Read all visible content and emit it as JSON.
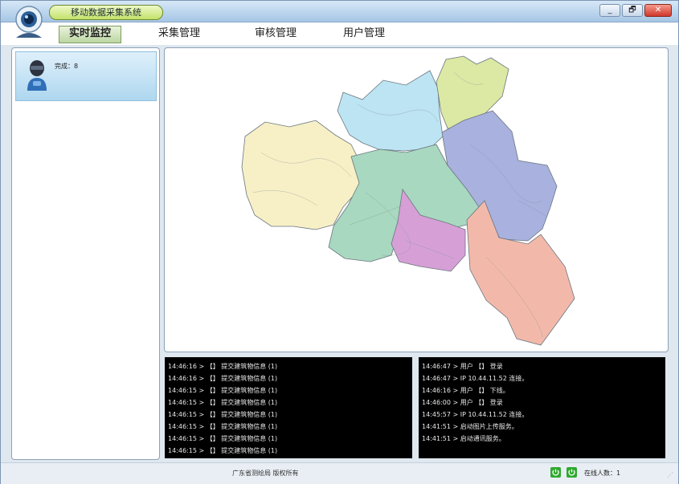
{
  "window": {
    "title": "移动数据采集系统",
    "buttons": {
      "minimize": "_",
      "restore": "🗗",
      "close": "✕"
    }
  },
  "menu": {
    "items": [
      "实时监控",
      "采集管理",
      "审核管理",
      "用户管理"
    ],
    "active_index": 0
  },
  "sidebar": {
    "users": [
      {
        "label": "完成：8",
        "icon": "user-icon"
      }
    ]
  },
  "logs": {
    "left": [
      "14:46:16 > 【】 提交建筑物信息 (1)",
      "14:46:16 > 【】 提交建筑物信息 (1)",
      "14:46:15 > 【】 提交建筑物信息 (1)",
      "14:46:15 > 【】 提交建筑物信息 (1)",
      "14:46:15 > 【】 提交建筑物信息 (1)",
      "14:46:15 > 【】 提交建筑物信息 (1)",
      "14:46:15 > 【】 提交建筑物信息 (1)",
      "14:46:15 > 【】 提交建筑物信息 (1)"
    ],
    "right": [
      "14:46:47 > 用户 【】 登录",
      "14:46:47 > IP 10.44.11.52 连接。",
      "14:46:16 > 用户 【】 下线。",
      "14:46:00 > 用户 【】 登录",
      "14:45:57 > IP 10.44.11.52 连接。",
      "14:41:51 > 启动图片上传服务。",
      "14:41:51 > 启动通讯服务。"
    ]
  },
  "status": {
    "copyright": "广东省测绘局 版权所有",
    "online": "在线人数：1",
    "power_color": "#2fa82f"
  },
  "map": {
    "region_colors": [
      "#f7f0c6",
      "#bde4f2",
      "#dbe9a4",
      "#a9b1de",
      "#a8d8bf",
      "#d6a0d6",
      "#f2b9aa"
    ]
  }
}
